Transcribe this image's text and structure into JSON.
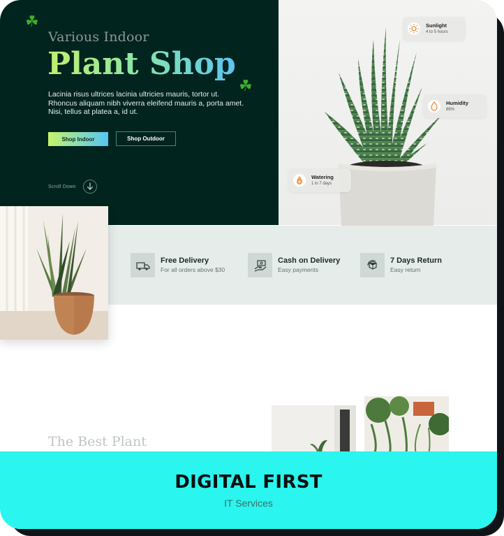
{
  "hero": {
    "eyebrow": "Various Indoor",
    "title": "Plant Shop",
    "description": "Lacinia risus ultrices lacinia ultricies mauris, tortor ut. Rhoncus aliquam nibh viverra eleifend mauris a, porta amet. Nisi, tellus at platea a, id ut.",
    "primary_button": "Shop Indoor",
    "secondary_button": "Shop Outdoor",
    "scroll_label": "Scroll Down"
  },
  "care": [
    {
      "title": "Sunlight",
      "sub": "4 to 5 hours",
      "icon": "sun-icon"
    },
    {
      "title": "Humidity",
      "sub": "86%",
      "icon": "droplet-icon"
    },
    {
      "title": "Watering",
      "sub": "1 in 7 days",
      "icon": "watering-icon"
    }
  ],
  "features": [
    {
      "title": "Free Delivery",
      "sub": "For all orders above $30",
      "icon": "delivery-truck-icon"
    },
    {
      "title": "Cash on Delivery",
      "sub": "Easy payments",
      "icon": "cash-hand-icon"
    },
    {
      "title": "7 Days Return",
      "sub": "Easy return",
      "icon": "return-box-icon"
    }
  ],
  "section": {
    "title": "The Best Plant"
  },
  "footer": {
    "brand": "DIGITAL FIRST",
    "subtitle": "IT Services"
  },
  "colors": {
    "hero_bg": "#02241f",
    "gradient_start": "#c5f46b",
    "gradient_end": "#55c6f5",
    "band_bg": "#e6ecea",
    "footer_bg": "#2af5ee",
    "care_icon": "#f08a3c"
  }
}
